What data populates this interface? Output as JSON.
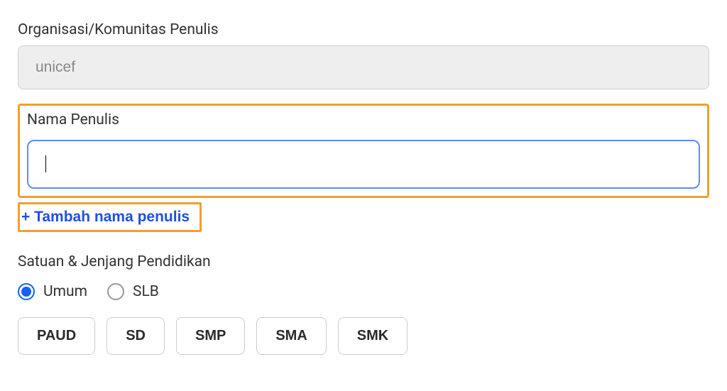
{
  "organization": {
    "label": "Organisasi/Komunitas Penulis",
    "value": "unicef"
  },
  "author": {
    "label": "Nama Penulis",
    "value": "",
    "add_button_label": "+ Tambah nama penulis"
  },
  "education": {
    "label": "Satuan & Jenjang Pendidikan",
    "radios": [
      {
        "label": "Umum",
        "selected": true
      },
      {
        "label": "SLB",
        "selected": false
      }
    ],
    "levels": [
      "PAUD",
      "SD",
      "SMP",
      "SMA",
      "SMK"
    ]
  }
}
